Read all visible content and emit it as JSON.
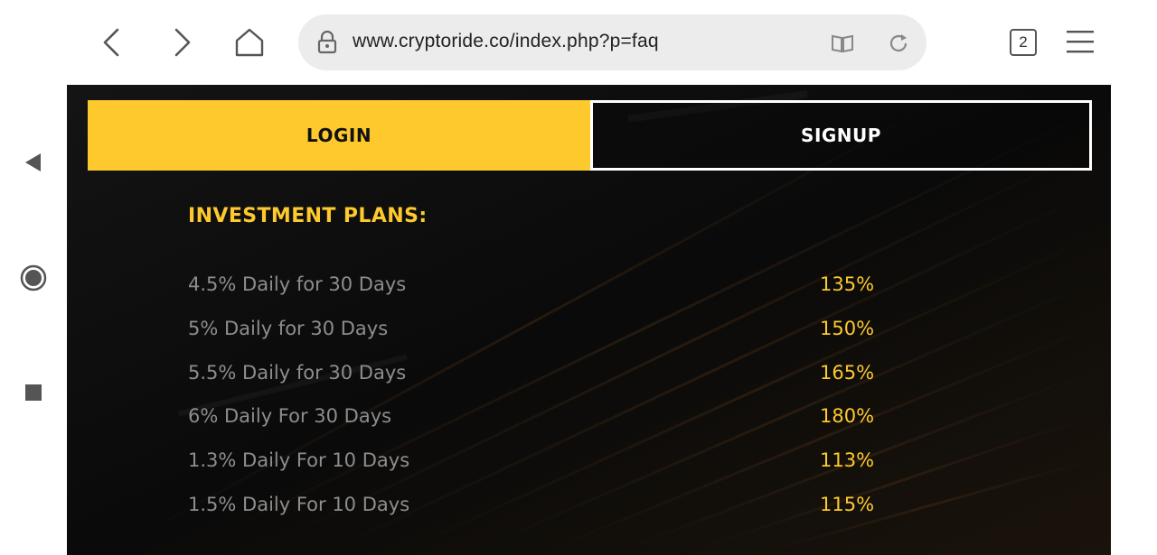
{
  "browser": {
    "url": "www.cryptoride.co/index.php?p=faq",
    "tab_count": "2"
  },
  "auth": {
    "login_label": "LOGIN",
    "signup_label": "SIGNUP"
  },
  "plans": {
    "title": "INVESTMENT PLANS:",
    "items": [
      {
        "name": "4.5% Daily for 30 Days",
        "return": "135%"
      },
      {
        "name": "5% Daily for 30 Days",
        "return": "150%"
      },
      {
        "name": "5.5% Daily for 30 Days",
        "return": "165%"
      },
      {
        "name": "6% Daily For 30 Days",
        "return": "180%"
      },
      {
        "name": "1.3% Daily For 10 Days",
        "return": "113%"
      },
      {
        "name": "1.5% Daily For 10 Days",
        "return": "115%"
      }
    ]
  },
  "colors": {
    "accent": "#fdc92c",
    "background": "#0b0b0b",
    "muted_text": "#8d8d8d"
  },
  "icons": {
    "sys_back": "back-triangle-icon",
    "sys_home": "home-circle-icon",
    "sys_recent": "recent-square-icon",
    "nav_back": "chevron-left-icon",
    "nav_forward": "chevron-right-icon",
    "home": "home-icon",
    "lock": "lock-icon",
    "reader": "book-icon",
    "reload": "reload-icon",
    "menu": "hamburger-menu-icon"
  }
}
